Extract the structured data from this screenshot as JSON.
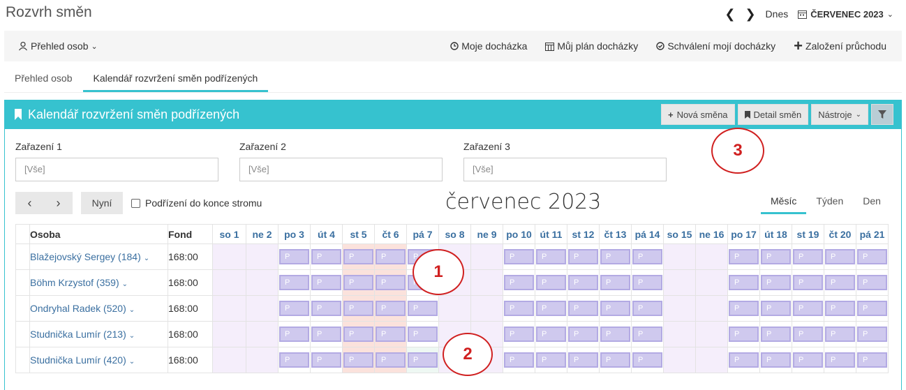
{
  "app": {
    "title": "Rozvrh směn"
  },
  "topnav": {
    "prev": "❮",
    "next": "❯",
    "today": "Dnes",
    "month": "ČERVENEC 2023"
  },
  "toolbar": {
    "people_menu": "Přehled osob",
    "my_attendance": "Moje docházka",
    "my_plan": "Můj plán docházky",
    "approval": "Schválení mojí docházky",
    "create_pass": "Založení průchodu"
  },
  "tabs": [
    {
      "label": "Přehled osob"
    },
    {
      "label": "Kalendář rozvržení směn podřízených"
    }
  ],
  "panel": {
    "title": "Kalendář rozvržení směn podřízených",
    "new_shift": "Nová směna",
    "detail": "Detail směn",
    "tools": "Nástroje"
  },
  "filters": [
    {
      "label": "Zařazení 1",
      "value": "[Vše]"
    },
    {
      "label": "Zařazení 2",
      "value": "[Vše]"
    },
    {
      "label": "Zařazení 3",
      "value": "[Vše]"
    }
  ],
  "calendar": {
    "prev": "‹",
    "next": "›",
    "now": "Nyní",
    "subordinates_label": "Podřízení do konce stromu",
    "subordinates_checked": false,
    "title": "červenec 2023",
    "views": [
      "Měsíc",
      "Týden",
      "Den"
    ],
    "active_view": "Měsíc",
    "col_person": "Osoba",
    "col_fund": "Fond",
    "days": [
      "so 1",
      "ne 2",
      "po 3",
      "út 4",
      "st 5",
      "čt 6",
      "pá 7",
      "so 8",
      "ne 9",
      "po 10",
      "út 11",
      "st 12",
      "čt 13",
      "pá 14",
      "so 15",
      "ne 16",
      "po 17",
      "út 18",
      "st 19",
      "čt 20",
      "pá 21"
    ],
    "weekend_days": [
      0,
      1,
      7,
      8,
      14,
      15
    ],
    "rows": [
      {
        "name": "Blažejovský Sergey (184)",
        "fund": "168:00"
      },
      {
        "name": "Böhm Krzystof (359)",
        "fund": "168:00"
      },
      {
        "name": "Ondryhal Radek (520)",
        "fund": "168:00"
      },
      {
        "name": "Studnička Lumír (213)",
        "fund": "168:00"
      },
      {
        "name": "Studnička Lumír (420)",
        "fund": "168:00"
      }
    ],
    "shift_label": "P"
  },
  "callouts": [
    "1",
    "2",
    "3"
  ],
  "colors": {
    "accent": "#36c2cf",
    "shift": "#cfc9ee",
    "weekend": "#f5eefb",
    "callout": "#d02020"
  }
}
